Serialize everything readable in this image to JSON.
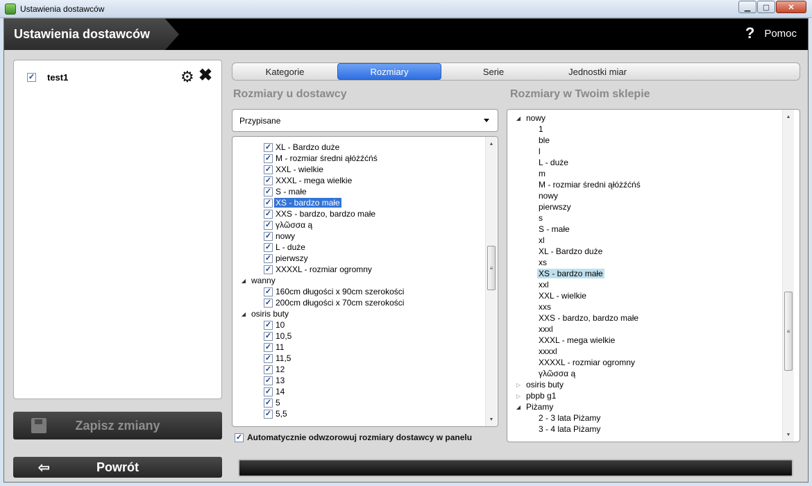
{
  "window": {
    "title": "Ustawienia dostawców"
  },
  "header": {
    "title": "Ustawienia dostawców",
    "help_label": "Pomoc"
  },
  "suppliers": [
    {
      "name": "test1",
      "checked": true
    }
  ],
  "buttons": {
    "save": "Zapisz zmiany",
    "back": "Powrót"
  },
  "tabs": [
    {
      "label": "Kategorie",
      "active": false
    },
    {
      "label": "Rozmiary",
      "active": true
    },
    {
      "label": "Serie",
      "active": false
    },
    {
      "label": "Jednostki miar",
      "active": false
    }
  ],
  "supplier_sizes": {
    "title": "Rozmiary u dostawcy",
    "filter": "Przypisane",
    "items": [
      {
        "label": "XL - Bardzo duże",
        "level": 1,
        "checked": true
      },
      {
        "label": "M - rozmiar średni ąłóżźćńś",
        "level": 1,
        "checked": true
      },
      {
        "label": "XXL - wielkie",
        "level": 1,
        "checked": true
      },
      {
        "label": "XXXL - mega wielkie",
        "level": 1,
        "checked": true
      },
      {
        "label": "S - małe",
        "level": 1,
        "checked": true
      },
      {
        "label": "XS - bardzo małe",
        "level": 1,
        "checked": true,
        "selected": true
      },
      {
        "label": "XXS - bardzo, bardzo małe",
        "level": 1,
        "checked": true
      },
      {
        "label": "γλῶσσα ą",
        "level": 1,
        "checked": true
      },
      {
        "label": "nowy",
        "level": 1,
        "checked": true
      },
      {
        "label": "L - duże",
        "level": 1,
        "checked": true
      },
      {
        "label": "pierwszy",
        "level": 1,
        "checked": true
      },
      {
        "label": "XXXXL - rozmiar ogromny",
        "level": 1,
        "checked": true
      },
      {
        "label": "wanny",
        "level": 0,
        "expanded": true
      },
      {
        "label": "160cm długości x 90cm szerokości",
        "level": 1,
        "checked": true
      },
      {
        "label": "200cm długości x 70cm szerokości",
        "level": 1,
        "checked": true
      },
      {
        "label": "osiris buty",
        "level": 0,
        "expanded": true
      },
      {
        "label": "10",
        "level": 1,
        "checked": true
      },
      {
        "label": "10,5",
        "level": 1,
        "checked": true
      },
      {
        "label": "11",
        "level": 1,
        "checked": true
      },
      {
        "label": "11,5",
        "level": 1,
        "checked": true
      },
      {
        "label": "12",
        "level": 1,
        "checked": true
      },
      {
        "label": "13",
        "level": 1,
        "checked": true
      },
      {
        "label": "14",
        "level": 1,
        "checked": true
      },
      {
        "label": "5",
        "level": 1,
        "checked": true
      },
      {
        "label": "5,5",
        "level": 1,
        "checked": true
      }
    ],
    "auto_map": {
      "label": "Automatycznie odwzorowuj rozmiary dostawcy w panelu",
      "checked": true
    }
  },
  "shop_sizes": {
    "title": "Rozmiary w Twoim sklepie",
    "items": [
      {
        "label": "nowy",
        "level": 0,
        "expanded": true
      },
      {
        "label": "1",
        "level": 1
      },
      {
        "label": "ble",
        "level": 1
      },
      {
        "label": "l",
        "level": 1
      },
      {
        "label": "L - duże",
        "level": 1
      },
      {
        "label": "m",
        "level": 1
      },
      {
        "label": "M - rozmiar średni ąłóżźćńś",
        "level": 1
      },
      {
        "label": "nowy",
        "level": 1
      },
      {
        "label": "pierwszy",
        "level": 1
      },
      {
        "label": "s",
        "level": 1
      },
      {
        "label": "S - małe",
        "level": 1
      },
      {
        "label": "xl",
        "level": 1
      },
      {
        "label": "XL - Bardzo duże",
        "level": 1
      },
      {
        "label": "xs",
        "level": 1
      },
      {
        "label": "XS - bardzo małe",
        "level": 1,
        "highlighted": true
      },
      {
        "label": "xxl",
        "level": 1
      },
      {
        "label": "XXL - wielkie",
        "level": 1
      },
      {
        "label": "xxs",
        "level": 1
      },
      {
        "label": "XXS - bardzo, bardzo małe",
        "level": 1
      },
      {
        "label": "xxxl",
        "level": 1
      },
      {
        "label": "XXXL - mega wielkie",
        "level": 1
      },
      {
        "label": "xxxxl",
        "level": 1
      },
      {
        "label": "XXXXL - rozmiar ogromny",
        "level": 1
      },
      {
        "label": "γλῶσσα ą",
        "level": 1
      },
      {
        "label": "osiris buty",
        "level": 0,
        "expanded": false
      },
      {
        "label": "pbpb g1",
        "level": 0,
        "expanded": false
      },
      {
        "label": "Piżamy",
        "level": 0,
        "expanded": true
      },
      {
        "label": "2 - 3 lata Piżamy",
        "level": 1
      },
      {
        "label": "3 - 4 lata Piżamy",
        "level": 1
      }
    ]
  },
  "icons": {
    "app": "app-icon",
    "help": "question-mark-icon",
    "settings": "gear-icon",
    "delete": "x-icon",
    "save": "floppy-disk-icon",
    "back": "exit-arrow-icon"
  },
  "colors": {
    "accent": "#3375d6",
    "header": "#000000",
    "highlight": "#bde0ee"
  }
}
